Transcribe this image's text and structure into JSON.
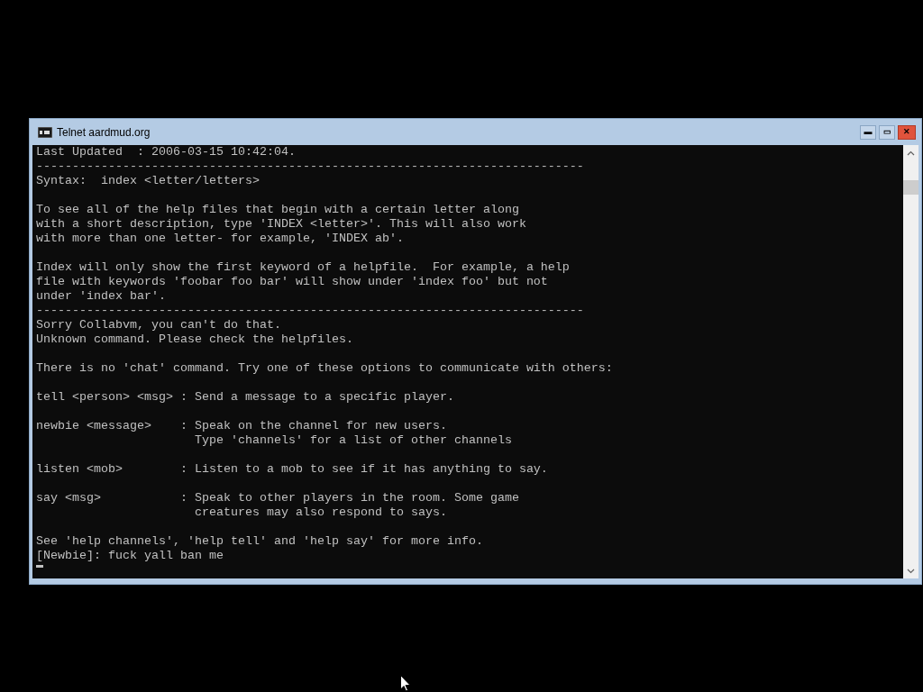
{
  "window": {
    "title": "Telnet aardmud.org",
    "controls": [
      "▬",
      "▭",
      "✕"
    ]
  },
  "console": {
    "paragraphs": [
      [
        "Last Updated  : 2006-03-15 10:42:04.",
        "----------------------------------------------------------------------------",
        "Syntax:  index <letter/letters>"
      ],
      [
        "To see all of the help files that begin with a certain letter along",
        "with a short description, type 'INDEX <letter>'. This will also work",
        "with more than one letter- for example, 'INDEX ab'."
      ],
      [
        "Index will only show the first keyword of a helpfile.  For example, a help",
        "file with keywords 'foobar foo bar' will show under 'index foo' but not",
        "under 'index bar'.",
        "----------------------------------------------------------------------------",
        "Sorry Collabvm, you can't do that.",
        "Unknown command. Please check the helpfiles."
      ],
      [
        "There is no 'chat' command. Try one of these options to communicate with others:"
      ],
      [
        "tell <person> <msg> : Send a message to a specific player."
      ],
      [
        "newbie <message>    : Speak on the channel for new users.",
        "                      Type 'channels' for a list of other channels"
      ],
      [
        "listen <mob>        : Listen to a mob to see if it has anything to say."
      ],
      [
        "say <msg>           : Speak to other players in the room. Some game",
        "                      creatures may also respond to says."
      ],
      [
        "See 'help channels', 'help tell' and 'help say' for more info.",
        "[Newbie]: fuck yall ban me"
      ]
    ]
  }
}
